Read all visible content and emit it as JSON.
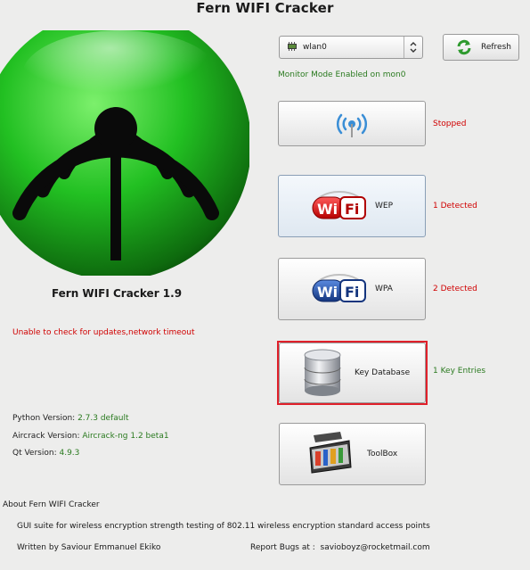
{
  "window": {
    "title": "Fern WIFI Cracker"
  },
  "app": {
    "name": "Fern WIFI Cracker 1.9"
  },
  "update_message": "Unable to check for updates,network timeout",
  "versions": [
    {
      "label": "Python Version:",
      "value": "2.7.3 default"
    },
    {
      "label": "Aircrack Version:",
      "value": "Aircrack-ng 1.2 beta1"
    },
    {
      "label": "Qt Version:",
      "value": "4.9.3"
    }
  ],
  "interface_select": {
    "value": "wlan0"
  },
  "refresh": {
    "label": "Refresh"
  },
  "monitor_status": "Monitor Mode Enabled on mon0",
  "scan": {
    "status": "Stopped"
  },
  "wep": {
    "label": "WEP",
    "status": "1 Detected",
    "logo_text": "WiFi"
  },
  "wpa": {
    "label": "WPA",
    "status": "2 Detected",
    "logo_text": "WiFi"
  },
  "key_database": {
    "label": "Key Database",
    "status": "1 Key Entries"
  },
  "toolbox": {
    "label": "ToolBox"
  },
  "about": {
    "heading": "About Fern WIFI Cracker",
    "description": "GUI suite for wireless  encryption strength testing of 802.11 wireless encryption standard access points",
    "author": "Written by Saviour Emmanuel Ekiko",
    "report_label": "Report Bugs at :",
    "report_email": "savioboyz@rocketmail.com"
  },
  "colors": {
    "status_red": "#d00000",
    "status_green": "#2a7a1f",
    "highlight": "#e0202a",
    "logo_green": "#22c022"
  },
  "icons": [
    "wifi-logo",
    "chip-icon",
    "spinner-arrows-icon",
    "refresh-icon",
    "antenna-icon",
    "wifi-wep-logo",
    "wifi-wpa-logo",
    "database-icon",
    "toolbox-icon"
  ]
}
